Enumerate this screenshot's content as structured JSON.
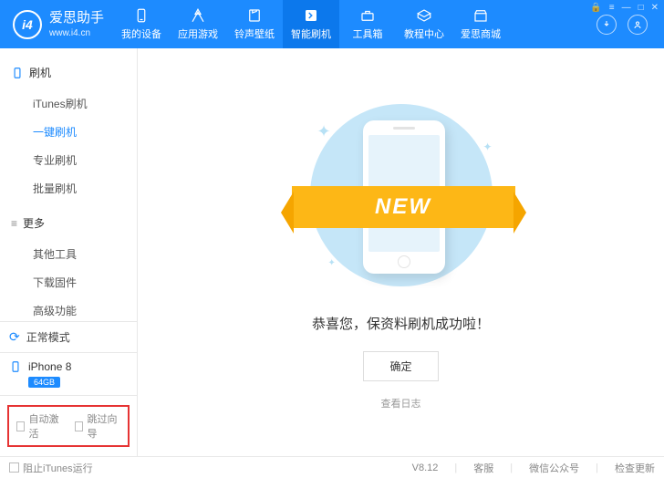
{
  "app": {
    "name": "爱思助手",
    "url": "www.i4.cn",
    "logoText": "i4"
  },
  "nav": {
    "items": [
      {
        "label": "我的设备"
      },
      {
        "label": "应用游戏"
      },
      {
        "label": "铃声壁纸"
      },
      {
        "label": "智能刷机"
      },
      {
        "label": "工具箱"
      },
      {
        "label": "教程中心"
      },
      {
        "label": "爱思商城"
      }
    ]
  },
  "sidebar": {
    "sections": [
      {
        "title": "刷机",
        "items": [
          "iTunes刷机",
          "一键刷机",
          "专业刷机",
          "批量刷机"
        ]
      },
      {
        "title": "更多",
        "items": [
          "其他工具",
          "下载固件",
          "高级功能"
        ]
      }
    ],
    "status": "正常模式",
    "device": {
      "name": "iPhone 8",
      "storage": "64GB"
    },
    "checks": {
      "autoActivate": "自动激活",
      "skipGuide": "跳过向导"
    }
  },
  "main": {
    "ribbon": "NEW",
    "message": "恭喜您，保资料刷机成功啦！",
    "okButton": "确定",
    "viewLog": "查看日志"
  },
  "footer": {
    "blockItunes": "阻止iTunes运行",
    "version": "V8.12",
    "support": "客服",
    "wechat": "微信公众号",
    "update": "检查更新"
  }
}
